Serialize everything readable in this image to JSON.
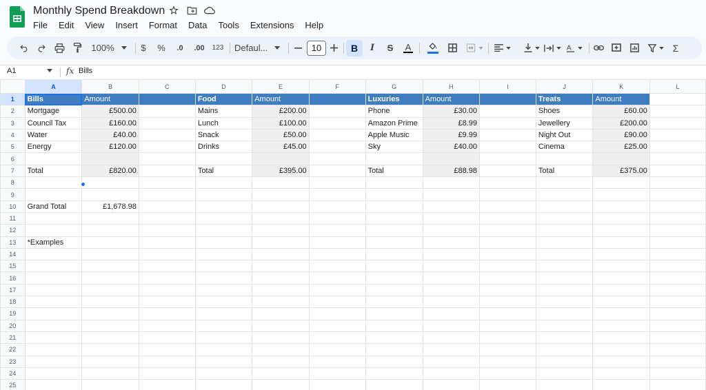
{
  "app": {
    "title": "Monthly Spend Breakdown",
    "menu": [
      "File",
      "Edit",
      "View",
      "Insert",
      "Format",
      "Data",
      "Tools",
      "Extensions",
      "Help"
    ]
  },
  "toolbar": {
    "zoom": "100%",
    "currency_symbol": "$",
    "percent_symbol": "%",
    "decrease_decimal": ".0",
    "increase_decimal": ".00",
    "number_format": "123",
    "font": "Defaul...",
    "font_size": "10",
    "bold_label": "B",
    "italic_label": "I",
    "strikethrough_label": "S",
    "text_color_label": "A",
    "sigma": "Σ",
    "accent_color": "#1a73e8",
    "header_fill_color": "#3f7cc0",
    "amount_fill_color": "#efefef"
  },
  "formula_bar": {
    "cell_ref": "A1",
    "fx": "fx",
    "value": "Bills"
  },
  "grid": {
    "columns": [
      "A",
      "B",
      "C",
      "D",
      "E",
      "F",
      "G",
      "H",
      "I",
      "J",
      "K",
      "L"
    ],
    "rows": [
      [
        "Bills",
        "Amount",
        "",
        "Food",
        "Amount",
        "",
        "Luxuries",
        "Amount",
        "",
        "Treats",
        "Amount",
        ""
      ],
      [
        "Mortgage",
        "£500.00",
        "",
        "Mains",
        "£200.00",
        "",
        "Phone",
        "£30.00",
        "",
        "Shoes",
        "£60.00",
        ""
      ],
      [
        "Council Tax",
        "£160.00",
        "",
        "Lunch",
        "£100.00",
        "",
        "Amazon Prime",
        "£8.99",
        "",
        "Jewellery",
        "£200.00",
        ""
      ],
      [
        "Water",
        "£40.00",
        "",
        "Snack",
        "£50.00",
        "",
        "Apple Music",
        "£9.99",
        "",
        "Night Out",
        "£90.00",
        ""
      ],
      [
        "Energy",
        "£120.00",
        "",
        "Drinks",
        "£45.00",
        "",
        "Sky",
        "£40.00",
        "",
        "Cinema",
        "£25.00",
        ""
      ],
      [
        "",
        "",
        "",
        "",
        "",
        "",
        "",
        "",
        "",
        "",
        "",
        ""
      ],
      [
        "Total",
        "£820.00",
        "",
        "Total",
        "£395.00",
        "",
        "Total",
        "£88.98",
        "",
        "Total",
        "£375.00",
        ""
      ],
      [
        "",
        "",
        "",
        "",
        "",
        "",
        "",
        "",
        "",
        "",
        "",
        ""
      ],
      [
        "",
        "",
        "",
        "",
        "",
        "",
        "",
        "",
        "",
        "",
        "",
        ""
      ],
      [
        "Grand Total",
        "£1,678.98",
        "",
        "",
        "",
        "",
        "",
        "",
        "",
        "",
        "",
        ""
      ],
      [
        "",
        "",
        "",
        "",
        "",
        "",
        "",
        "",
        "",
        "",
        "",
        ""
      ],
      [
        "",
        "",
        "",
        "",
        "",
        "",
        "",
        "",
        "",
        "",
        "",
        ""
      ],
      [
        "*Examples",
        "",
        "",
        "",
        "",
        "",
        "",
        "",
        "",
        "",
        "",
        ""
      ],
      [
        "",
        "",
        "",
        "",
        "",
        "",
        "",
        "",
        "",
        "",
        "",
        ""
      ],
      [
        "",
        "",
        "",
        "",
        "",
        "",
        "",
        "",
        "",
        "",
        "",
        ""
      ],
      [
        "",
        "",
        "",
        "",
        "",
        "",
        "",
        "",
        "",
        "",
        "",
        ""
      ],
      [
        "",
        "",
        "",
        "",
        "",
        "",
        "",
        "",
        "",
        "",
        "",
        ""
      ],
      [
        "",
        "",
        "",
        "",
        "",
        "",
        "",
        "",
        "",
        "",
        "",
        ""
      ],
      [
        "",
        "",
        "",
        "",
        "",
        "",
        "",
        "",
        "",
        "",
        "",
        ""
      ],
      [
        "",
        "",
        "",
        "",
        "",
        "",
        "",
        "",
        "",
        "",
        "",
        ""
      ],
      [
        "",
        "",
        "",
        "",
        "",
        "",
        "",
        "",
        "",
        "",
        "",
        ""
      ],
      [
        "",
        "",
        "",
        "",
        "",
        "",
        "",
        "",
        "",
        "",
        "",
        ""
      ],
      [
        "",
        "",
        "",
        "",
        "",
        "",
        "",
        "",
        "",
        "",
        "",
        ""
      ],
      [
        "",
        "",
        "",
        "",
        "",
        "",
        "",
        "",
        "",
        "",
        "",
        ""
      ],
      [
        "",
        "",
        "",
        "",
        "",
        "",
        "",
        "",
        "",
        "",
        "",
        ""
      ]
    ]
  }
}
